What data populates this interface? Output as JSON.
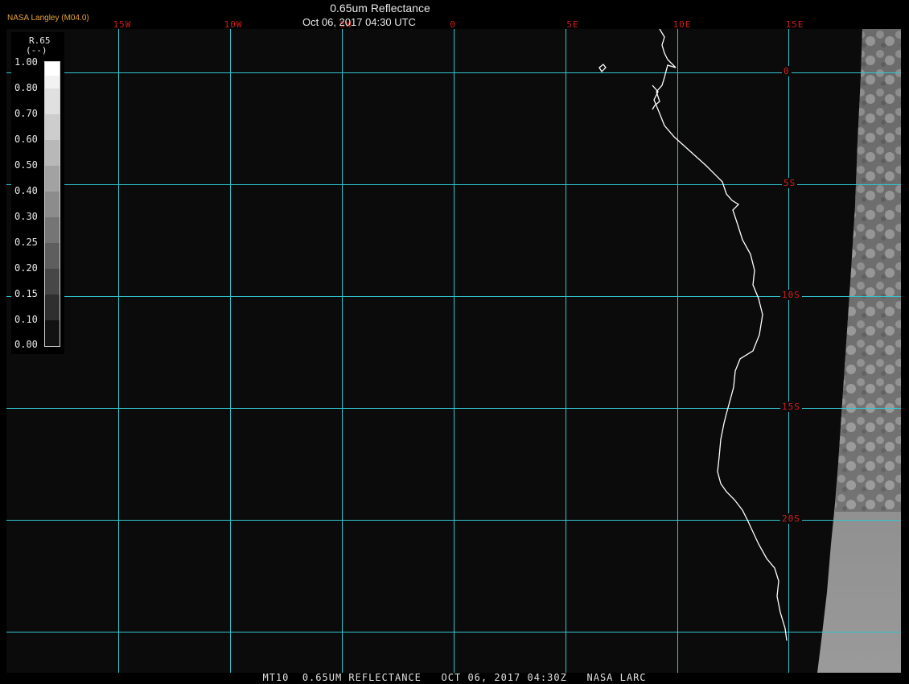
{
  "header": {
    "credit": "NASA Langley (M04.0)",
    "title": "0.65um Reflectance",
    "datetime": "Oct 06, 2017 04:30 UTC"
  },
  "grid": {
    "lon_labels": [
      "15W",
      "10W",
      "5W",
      "0",
      "5E",
      "10E",
      "15E"
    ],
    "lat_labels": [
      "0",
      "5S",
      "10S",
      "15S",
      "20S"
    ],
    "line_color": "#31c6d0",
    "label_color": "#d31d1d"
  },
  "colorbar": {
    "variable": "R.65",
    "unit": "(--)",
    "ticks": [
      "1.00",
      "0.80",
      "0.70",
      "0.60",
      "0.50",
      "0.40",
      "0.30",
      "0.25",
      "0.20",
      "0.15",
      "0.10",
      "0.00"
    ]
  },
  "map": {
    "coastline_color": "#ffffff",
    "background": "#0b0b0b"
  },
  "footer": {
    "caption": "MT10  0.65UM REFLECTANCE   OCT 06, 2017 04:30Z   NASA LARC"
  }
}
